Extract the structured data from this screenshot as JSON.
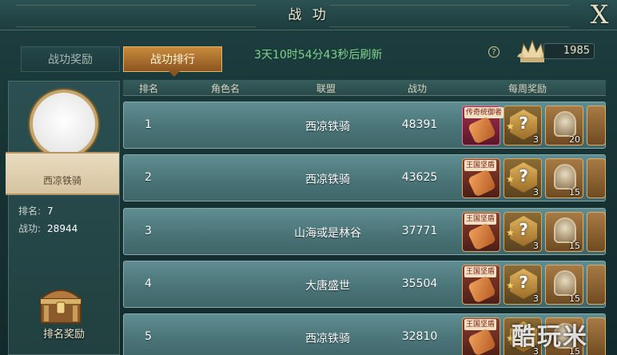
{
  "header": {
    "title": "战 功",
    "close_label": "X"
  },
  "tabs": [
    {
      "label": "战功奖励",
      "active": false
    },
    {
      "label": "战功排行",
      "active": true
    }
  ],
  "countdown": "3天10时54分43秒后刷新",
  "help_label": "?",
  "points": "1985",
  "player": {
    "name": "西凉铁骑",
    "rank_label": "排名:",
    "rank_value": "7",
    "merit_label": "战功:",
    "merit_value": "28944",
    "reward_button": "排名奖励"
  },
  "table": {
    "columns": [
      "排名",
      "角色名",
      "联盟",
      "战功",
      "每周奖励"
    ],
    "rows": [
      {
        "rank": "1",
        "alliance": "西凉铁骑",
        "merit": "48391",
        "scroll_tag": "传奇统御者",
        "medal_count": "3",
        "helm_count": "20",
        "legend": true
      },
      {
        "rank": "2",
        "alliance": "西凉铁骑",
        "merit": "43625",
        "scroll_tag": "王国坚盾",
        "medal_count": "3",
        "helm_count": "15",
        "legend": false
      },
      {
        "rank": "3",
        "alliance": "山海或是林谷",
        "merit": "37771",
        "scroll_tag": "王国坚盾",
        "medal_count": "3",
        "helm_count": "15",
        "legend": false
      },
      {
        "rank": "4",
        "alliance": "大唐盛世",
        "merit": "35504",
        "scroll_tag": "王国坚盾",
        "medal_count": "3",
        "helm_count": "15",
        "legend": false
      },
      {
        "rank": "5",
        "alliance": "西凉铁骑",
        "merit": "32810",
        "scroll_tag": "王国坚盾",
        "medal_count": "3",
        "helm_count": "15",
        "legend": false
      }
    ]
  },
  "watermark": "酷玩米",
  "colors": {
    "accent_gold": "#c98b3c",
    "countdown_green": "#7fd48b",
    "row_teal": "#4a7478"
  }
}
